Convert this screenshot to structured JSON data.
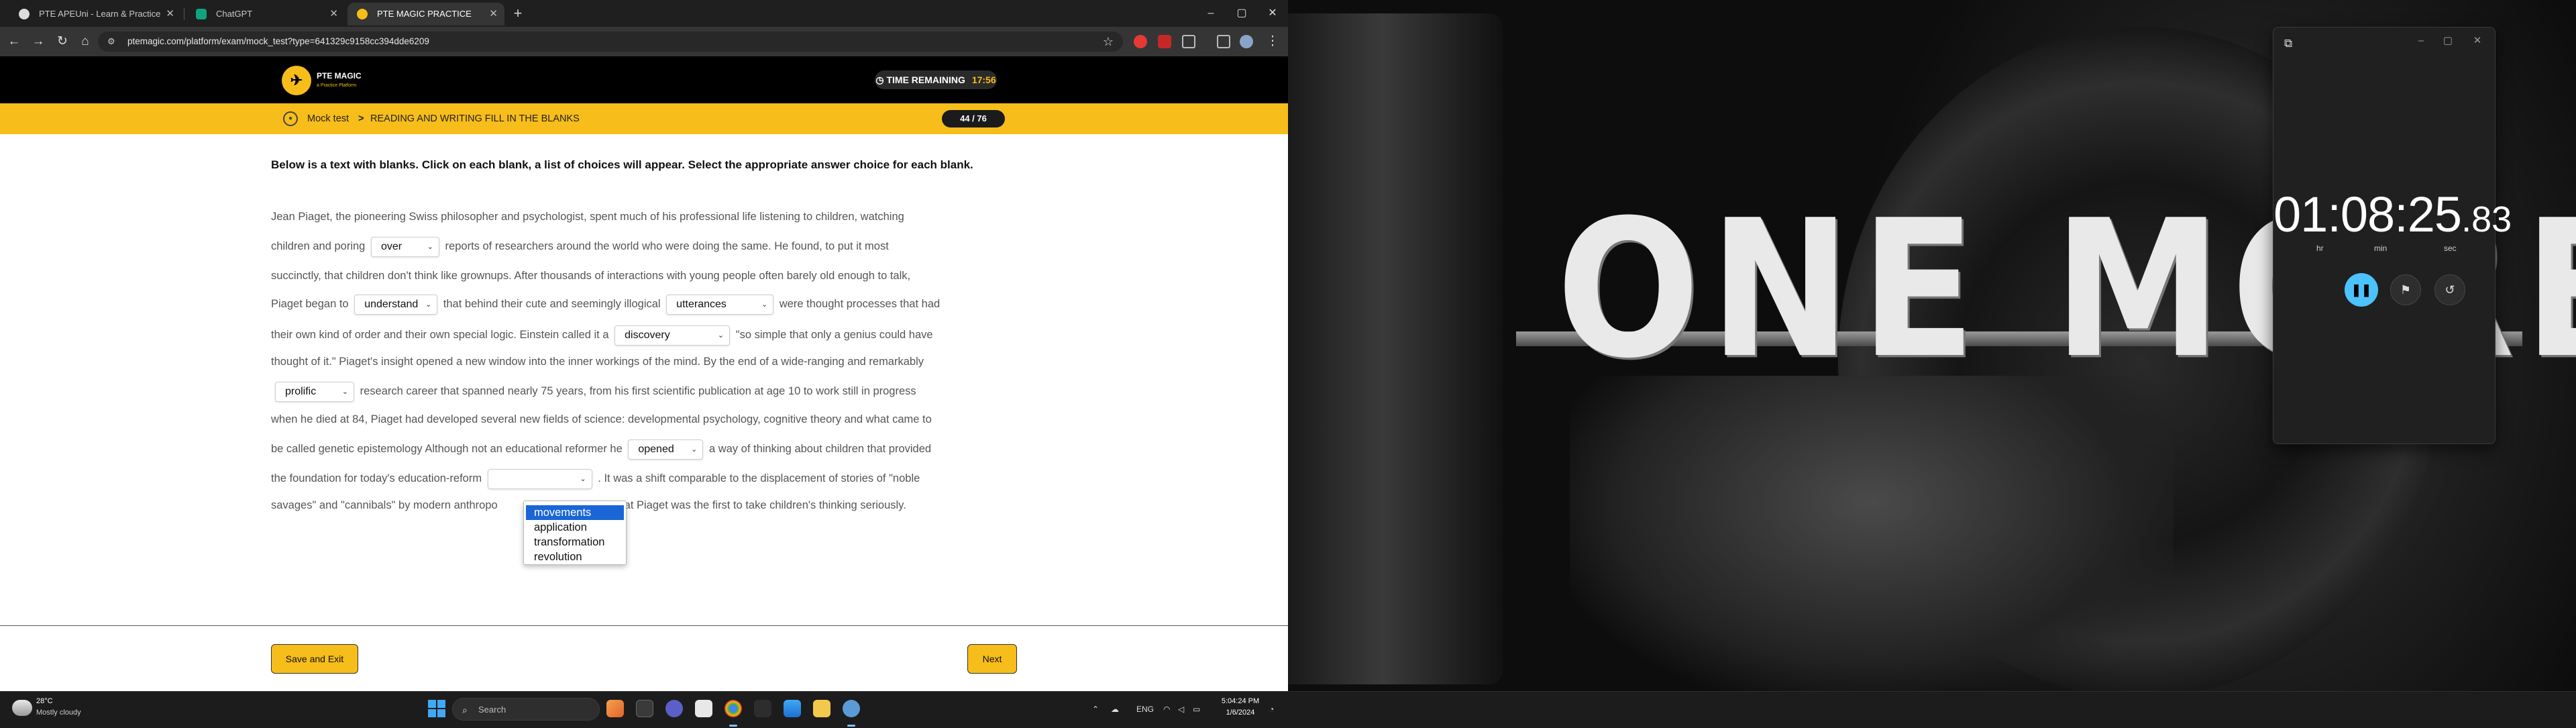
{
  "browser": {
    "tabs": [
      {
        "label": "PTE APEUni - Learn & Practice",
        "active": false
      },
      {
        "label": "ChatGPT",
        "active": false
      },
      {
        "label": "PTE MAGIC PRACTICE",
        "active": true
      }
    ],
    "url": "ptemagic.com/platform/exam/mock_test?type=641329c9158cc394dde6209",
    "window_controls": {
      "minimize": "–",
      "maximize": "▢",
      "close": "✕"
    }
  },
  "site": {
    "logo_text": "PTE MAGIC",
    "logo_sub": "a Practice Platform",
    "timer_label": "TIME REMAINING",
    "timer_value": "17:56",
    "breadcrumb": {
      "section": "Mock test",
      "separator": ">",
      "task": "READING AND WRITING FILL IN THE BLANKS"
    },
    "progress": "44 / 76"
  },
  "question": {
    "instruction": "Below is a text with blanks. Click on each blank, a list of choices will appear. Select the appropriate answer choice for each blank.",
    "lines": [
      {
        "a": "Jean Piaget, the pioneering Swiss philosopher and psychologist, spent much of his professional life listening to children, watching"
      },
      {
        "a": "children and poring",
        "b1": "over",
        "c": "reports of researchers around the world who were doing the same. He found, to put it most"
      },
      {
        "a": "succinctly, that children don't think like grownups. After thousands of interactions with young people often barely old enough to talk,"
      },
      {
        "a": "Piaget began to",
        "b1": "understand",
        "c": "that behind their cute and seemingly illogical",
        "b2": "utterances",
        "d": "were thought processes that had"
      },
      {
        "a": "their own kind of order and their own special logic. Einstein called it a",
        "b1": "discovery",
        "c": "\"so simple that only a genius could have"
      },
      {
        "a": "thought of it.\" Piaget's insight opened a new window into the inner workings of the mind. By the end of a wide-ranging and remarkably"
      },
      {
        "b1": "prolific",
        "c": "research career that spanned nearly 75 years, from his first scientific publication at age 10 to work still in progress"
      },
      {
        "a": "when he died at 84, Piaget had developed several new fields of science: developmental psychology, cognitive theory and what came to"
      },
      {
        "a": "be called genetic epistemology Although not an educational reformer he",
        "b1": "opened",
        "c": "a way of thinking about children that provided"
      },
      {
        "a": "the foundation for today's education-reform",
        "b1": "",
        "c": ". It was a shift comparable to the displacement of stories of \"noble"
      },
      {
        "a": "savages\" and \"cannibals\" by modern anthropo",
        "c": "that Piaget was the first to take children's thinking seriously."
      }
    ],
    "dropdown_options": [
      "movements",
      "application",
      "transformation",
      "revolution"
    ],
    "selected_option": "movements"
  },
  "buttons": {
    "save_exit": "Save and Exit",
    "next": "Next"
  },
  "wallpaper": {
    "text": "ONE MORE"
  },
  "clock_app": {
    "hours": "01",
    "minutes": "08",
    "seconds": "25",
    "hundredths": "83",
    "unit_hr": "hr",
    "unit_min": "min",
    "unit_sec": "sec"
  },
  "taskbar": {
    "weather_temp": "28°C",
    "weather_desc": "Mostly cloudy",
    "search_placeholder": "Search",
    "language": "ENG",
    "time": "5:04:24 PM",
    "date": "1/6/2024"
  },
  "colors": {
    "brand": "#f7bd1a",
    "selection": "#1a66d6",
    "accent_clock": "#4cc2ff"
  }
}
